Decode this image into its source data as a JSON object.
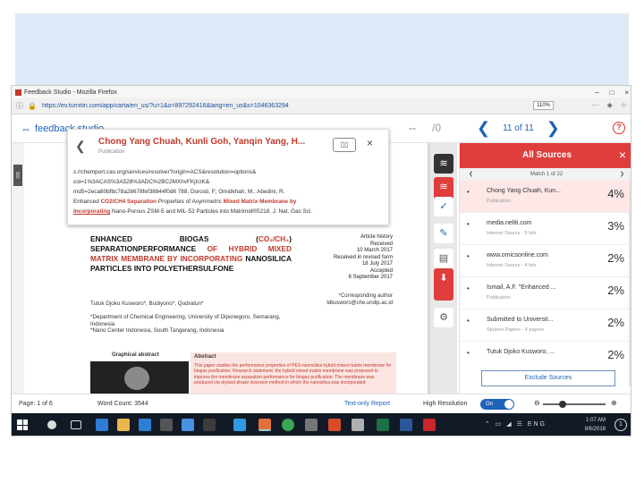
{
  "window": {
    "title": "Feedback Studio - Mozilla Firefox",
    "min": "–",
    "max": "□",
    "close": "×"
  },
  "urlbar": {
    "url": "https://ev.turnitin.com/app/carta/en_us/?u=1&o=897292416&lang=en_us&s=1046363294",
    "zoom": "110%",
    "more": "···",
    "shield": "◈",
    "star": "☆"
  },
  "header": {
    "logo": "feedback studio",
    "dash": "--",
    "slash": "/0",
    "page_label": "11 of 11",
    "prev": "❮",
    "next": "❯",
    "help": "?"
  },
  "popup": {
    "title": "Chong Yang Chuah, Kunli Goh, Yanqin Yang, H...",
    "subtitle": "Publication",
    "back": "❮",
    "close": "×",
    "body_1": "s://chemport.cas.org/services/resolver?origin=ACS&resolution=options&",
    "body_2": "coi=1%3ACAS%3A528%3ADC%2BC2MXhvFKjtrzK&",
    "body_3": "md5=2eca80bfbc78a28678fef38844f0d6 788. Dorosti, F; Omidkhah, M.; Abedini, R.",
    "body_4a": "Enhanced ",
    "body_4b": "CO2/CH4 Separation",
    "body_4c": " Properties of Asymmetric ",
    "body_4d": "Mixed Matrix Membrane by",
    "body_5a": "Incorporating",
    "body_5b": " Nano-Porous ZSM-5 and MIL-53 Particles into Matrimid®5218. J. Nat. Gas Sci."
  },
  "document": {
    "title_1": "Enhanced biogas (",
    "title_2": "CO₂/CH₄",
    "title_3": ") separation",
    "title_4": "performance ",
    "title_5": "of hybrid mixed matrix membrane by incorporating",
    "title_6": " nanosilica particles into polyethersulfone",
    "history": "Article history\nReceived\n10 March 2017\nReceived in revised form\n18 July 2017\nAccepted\n6 September 2017",
    "authors": "Tutuk Djoko Kusworo*, Budiyono*, Qudratun*",
    "affiliation": "*Department of Chemical Engineering, University of Diponegoro, Semarang, Indonesia\n*Nano Center Indonesia, South Tangerang, Indonesia",
    "corresponding": "*Corresponding author\ntdkusworo@che.undip.ac.id",
    "graphical_abstract": "Graphical abstract",
    "abstract_label": "Abstract",
    "abstract_text": "This paper studies the performance properties of PES-nanosilica hybrid mixed matrix membrane for biogas purification. Research statement: the hybrid mixed matrix membrane was proposed to improve the membrane separation performance for biogas purification. The membrane was produced via dry/wet phase inversion method in which the nanosilica was incorporated"
  },
  "panel": {
    "title": "All Sources",
    "close": "×",
    "match_label": "Match 1 of 22",
    "prev": "❮",
    "next": "❯",
    "sources": [
      {
        "bullet": "•",
        "name": "Chong Yang Chuah, Kun...",
        "type": "Publication",
        "percent": "4%"
      },
      {
        "bullet": "•",
        "name": "media.neliti.com",
        "type": "Internet Source - 5 hits",
        "percent": "3%"
      },
      {
        "bullet": "•",
        "name": "www.omicsonline.com",
        "type": "Internet Source - 4 hits",
        "percent": "2%"
      },
      {
        "bullet": "•",
        "name": "Ismail, A.F. \"Enhanced ...",
        "type": "Publication",
        "percent": "2%"
      },
      {
        "bullet": "•",
        "name": "Submitted to Universit...",
        "type": "Student Papers - 4 papers",
        "percent": "2%"
      },
      {
        "bullet": "•",
        "name": "Tutuk Djoko Kusworo, ...",
        "type": "",
        "percent": "2%"
      }
    ],
    "exclude_button": "Exclude Sources"
  },
  "tools": {
    "layers": "≋",
    "layers2": "≋",
    "check": "✓",
    "edit": "✎",
    "filter": "▤",
    "download": "⬇",
    "settings": "⚙"
  },
  "status": {
    "page": "Page: 1 of 6",
    "words": "Word Count: 3544",
    "text_only": "Text-only Report",
    "high_res": "High Resolution",
    "toggle": "On",
    "zoom_out": "⊖",
    "zoom_in": "⊕"
  },
  "taskbar": {
    "time": "1:07 AM",
    "date": "9/6/2018",
    "lang": "ENG",
    "tray_icons": "⌃ ▭ ◢ ☰ ENG",
    "notif": "1"
  },
  "colors": {
    "turnitin_red": "#e03d3d",
    "accent_blue": "#1f63b8",
    "highlight_red": "#c0392b",
    "banner": "#dceaf7"
  }
}
